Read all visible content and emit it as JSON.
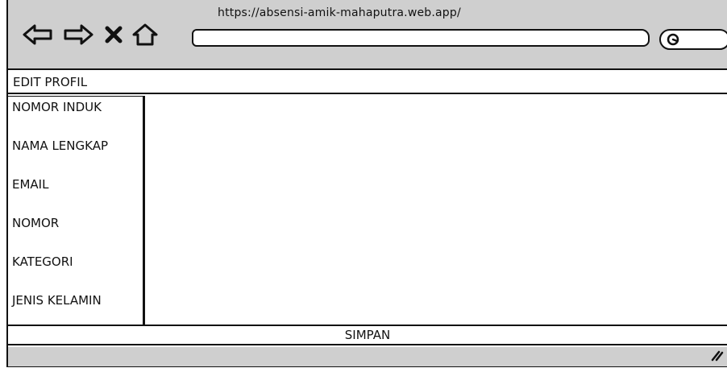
{
  "browser": {
    "url": "https://absensi-amik-mahaputra.web.app/",
    "address_value": "",
    "nav_icons": [
      "back-arrow-icon",
      "forward-arrow-icon",
      "close-icon",
      "home-icon"
    ],
    "search_icon": "search-icon"
  },
  "page": {
    "title": "EDIT PROFIL"
  },
  "form": {
    "fields": [
      {
        "label": "NOMOR INDUK"
      },
      {
        "label": "NAMA LENGKAP"
      },
      {
        "label": "EMAIL"
      },
      {
        "label": "NOMOR"
      },
      {
        "label": "KATEGORI"
      },
      {
        "label": "JENIS KELAMIN"
      }
    ],
    "submit_label": "SIMPAN"
  },
  "colors": {
    "toolbar_bg": "#cfcfcf",
    "outline": "#111111",
    "panel_bg": "#ffffff"
  }
}
